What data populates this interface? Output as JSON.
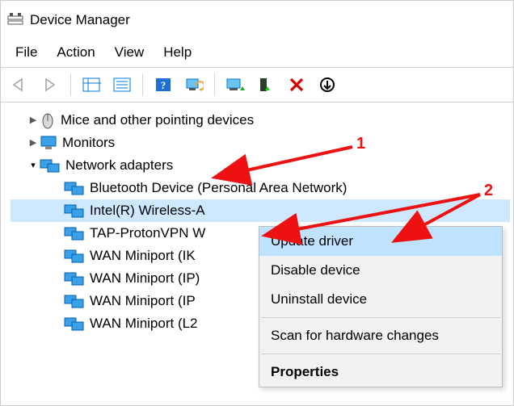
{
  "window": {
    "title": "Device Manager"
  },
  "menubar": {
    "file": "File",
    "action": "Action",
    "view": "View",
    "help": "Help"
  },
  "tree": {
    "mice": {
      "label": "Mice and other pointing devices"
    },
    "monitors": {
      "label": "Monitors"
    },
    "network": {
      "label": "Network adapters",
      "expanded": true,
      "children": [
        "Bluetooth Device (Personal Area Network)",
        "Intel(R) Wireless-A",
        "TAP-ProtonVPN W",
        "WAN Miniport (IK",
        "WAN Miniport (IP)",
        "WAN Miniport (IP",
        "WAN Miniport (L2"
      ]
    }
  },
  "context_menu": {
    "update": "Update driver",
    "disable": "Disable device",
    "uninstall": "Uninstall device",
    "scan": "Scan for hardware changes",
    "properties": "Properties"
  },
  "annotations": [
    "1",
    "2"
  ],
  "colors": {
    "accent": "#0078d7",
    "annotation": "#e11",
    "highlight": "#bfe3ff",
    "selection": "#cde8ff"
  }
}
